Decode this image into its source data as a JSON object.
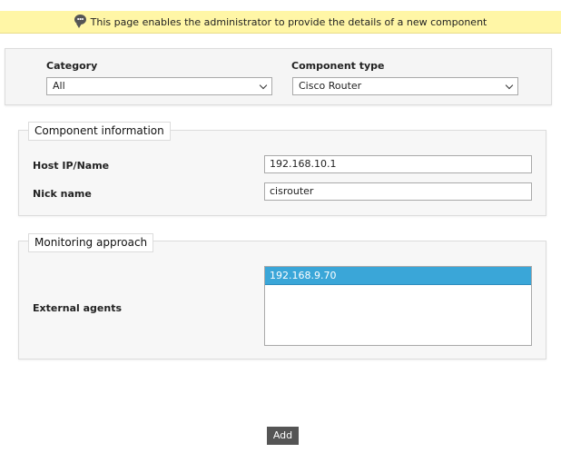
{
  "banner": {
    "text": "This page enables the administrator to provide the details of a new component",
    "icon": "speech-bubble-icon"
  },
  "category": {
    "label": "Category",
    "value": "All"
  },
  "component_type": {
    "label": "Component type",
    "value": "Cisco Router"
  },
  "component_info": {
    "legend": "Component information",
    "host_label": "Host IP/Name",
    "host_value": "192.168.10.1",
    "nick_label": "Nick name",
    "nick_value": "cisrouter"
  },
  "monitoring": {
    "legend": "Monitoring approach",
    "agents_label": "External agents",
    "agents": [
      "192.168.9.70"
    ]
  },
  "actions": {
    "add_label": "Add"
  },
  "colors": {
    "banner_bg": "#fff6a6",
    "selected_option": "#3aa6d8",
    "button_bg": "#555555"
  }
}
